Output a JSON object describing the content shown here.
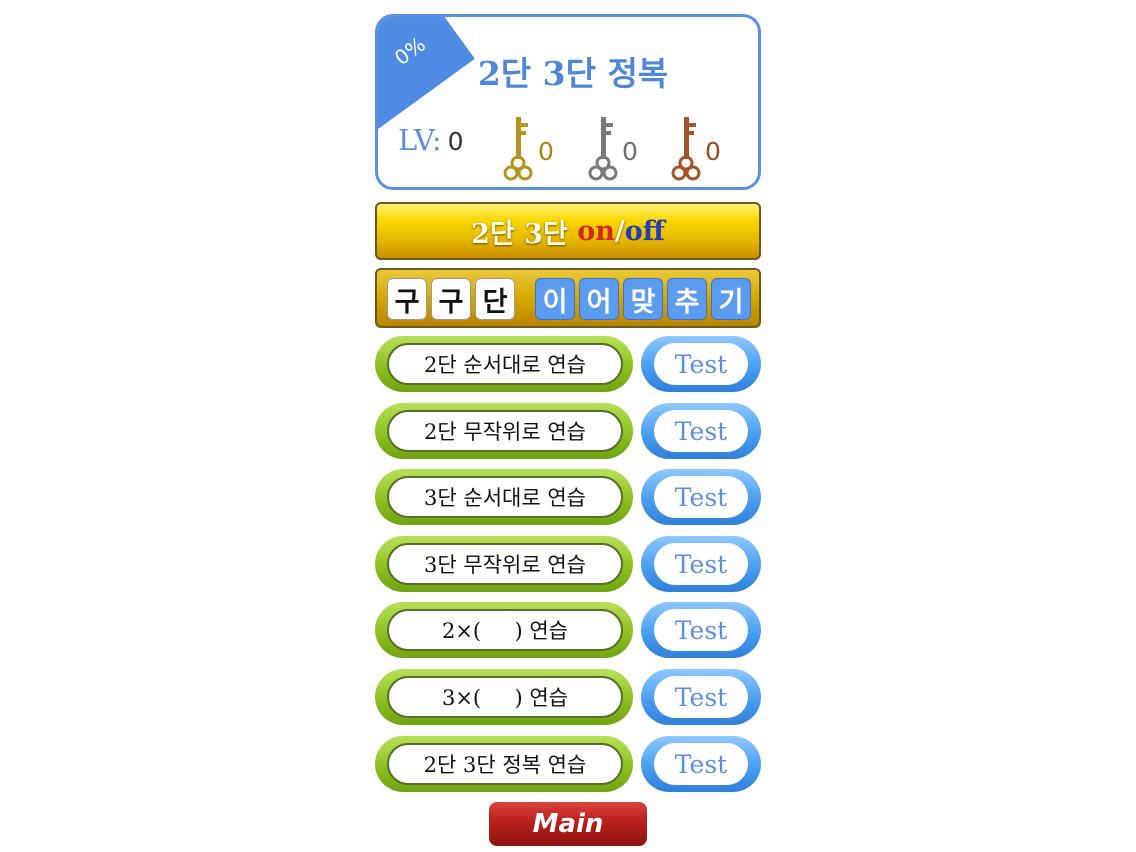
{
  "header": {
    "progress": "0%",
    "title": "2단 3단 정복",
    "level_label": "LV:",
    "level_value": "0",
    "keys": [
      {
        "icon": "gold-key-icon",
        "color": "#a98410",
        "count": "0"
      },
      {
        "icon": "silver-key-icon",
        "color": "#6e6e6e",
        "count": "0"
      },
      {
        "icon": "bronze-key-icon",
        "color": "#9a4a1c",
        "count": "0"
      }
    ]
  },
  "toggle": {
    "prefix": "2단 3단 ",
    "on": "on",
    "slash": "/",
    "off": "off"
  },
  "game": {
    "white_tiles": [
      "구",
      "구",
      "단"
    ],
    "blue_tiles": [
      "이",
      "어",
      "맞",
      "추",
      "기"
    ]
  },
  "practice": [
    {
      "label": "2단 순서대로 연습",
      "test": "Test"
    },
    {
      "label": "2단 무작위로 연습",
      "test": "Test"
    },
    {
      "label": "3단 순서대로 연습",
      "test": "Test"
    },
    {
      "label": "3단 무작위로 연습",
      "test": "Test"
    },
    {
      "label": "2×(     ) 연습",
      "test": "Test"
    },
    {
      "label": "3×(     ) 연습",
      "test": "Test"
    },
    {
      "label": "2단 3단 정복 연습",
      "test": "Test"
    }
  ],
  "main_button": "Main",
  "colors": {
    "accent_blue": "#5b8fe0",
    "green": "#8bc21d",
    "gold": "#e3b400",
    "red": "#b91f1a"
  }
}
